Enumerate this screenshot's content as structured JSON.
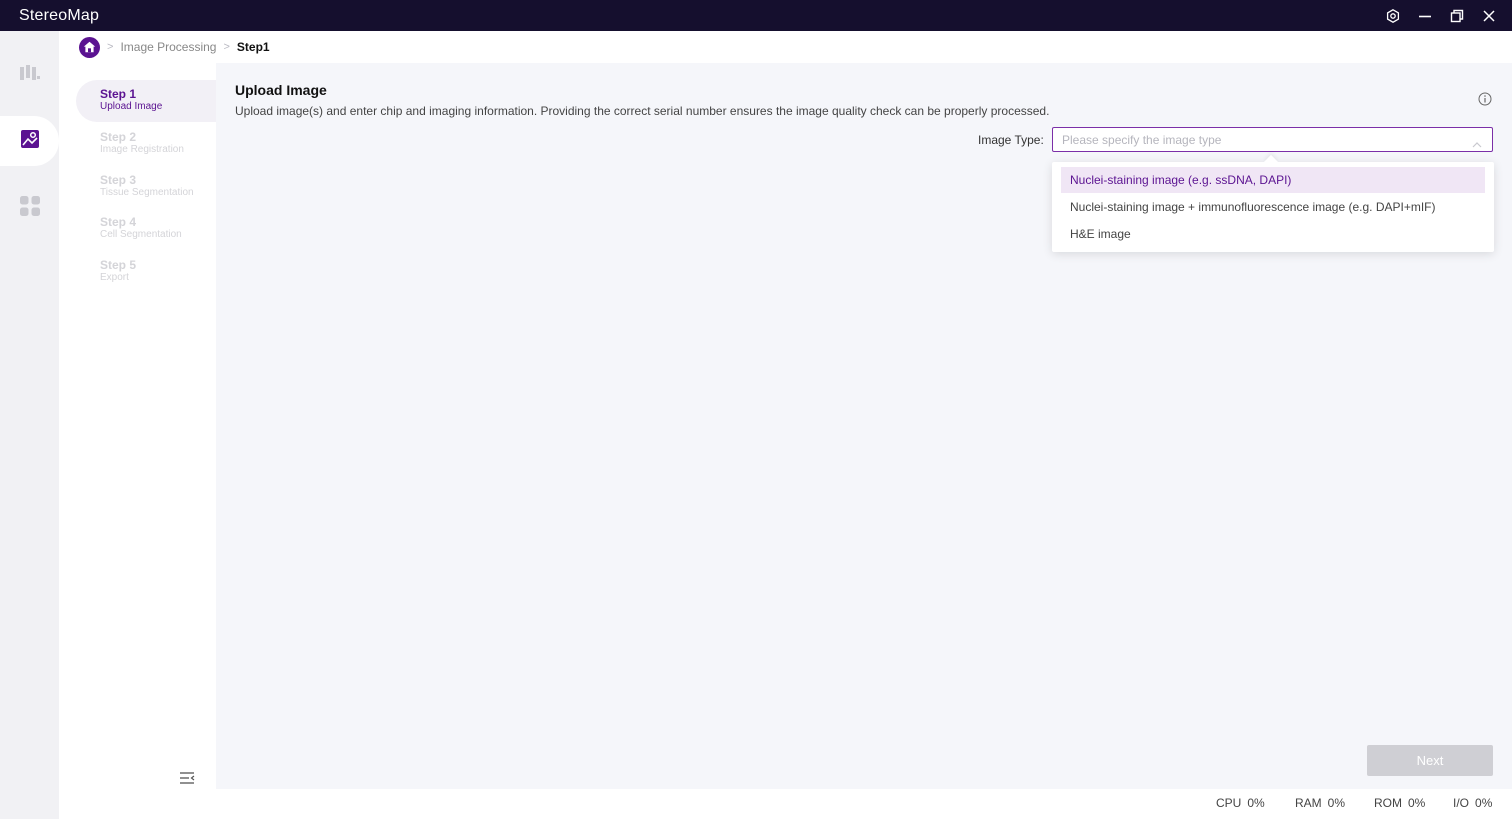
{
  "app": {
    "title": "StereoMap"
  },
  "window_controls": [
    "settings-icon",
    "minimize-icon",
    "restore-icon",
    "close-icon"
  ],
  "rail": {
    "items": [
      {
        "name": "map-icon",
        "active": false
      },
      {
        "name": "image-icon",
        "active": true
      },
      {
        "name": "apps-icon",
        "active": false
      }
    ]
  },
  "breadcrumb": {
    "items": [
      "Image Processing",
      "Step1"
    ]
  },
  "steps": [
    {
      "title": "Step 1",
      "subtitle": "Upload Image",
      "active": true
    },
    {
      "title": "Step 2",
      "subtitle": "Image Registration",
      "active": false
    },
    {
      "title": "Step 3",
      "subtitle": "Tissue Segmentation",
      "active": false
    },
    {
      "title": "Step 4",
      "subtitle": "Cell Segmentation",
      "active": false
    },
    {
      "title": "Step 5",
      "subtitle": "Export",
      "active": false
    }
  ],
  "main": {
    "heading": "Upload Image",
    "description": "Upload image(s) and enter chip and imaging information. Providing the correct serial number ensures the image quality check can be properly processed.",
    "image_type": {
      "label": "Image Type:",
      "placeholder": "Please specify the image type",
      "options": [
        {
          "label": "Nuclei-staining image (e.g. ssDNA, DAPI)",
          "highlighted": true
        },
        {
          "label": "Nuclei-staining image + immunofluorescence image (e.g. DAPI+mIF)",
          "highlighted": false
        },
        {
          "label": "H&E image",
          "highlighted": false
        }
      ]
    },
    "next_label": "Next"
  },
  "status": {
    "cpu": {
      "label": "CPU",
      "value": "0%"
    },
    "ram": {
      "label": "RAM",
      "value": "0%"
    },
    "rom": {
      "label": "ROM",
      "value": "0%"
    },
    "io": {
      "label": "I/O",
      "value": "0%"
    }
  },
  "colors": {
    "titlebar": "#150f2e",
    "accent": "#5b1391",
    "selected_option_bg": "#f0e6f5",
    "disabled_button": "#cfcfd4"
  }
}
